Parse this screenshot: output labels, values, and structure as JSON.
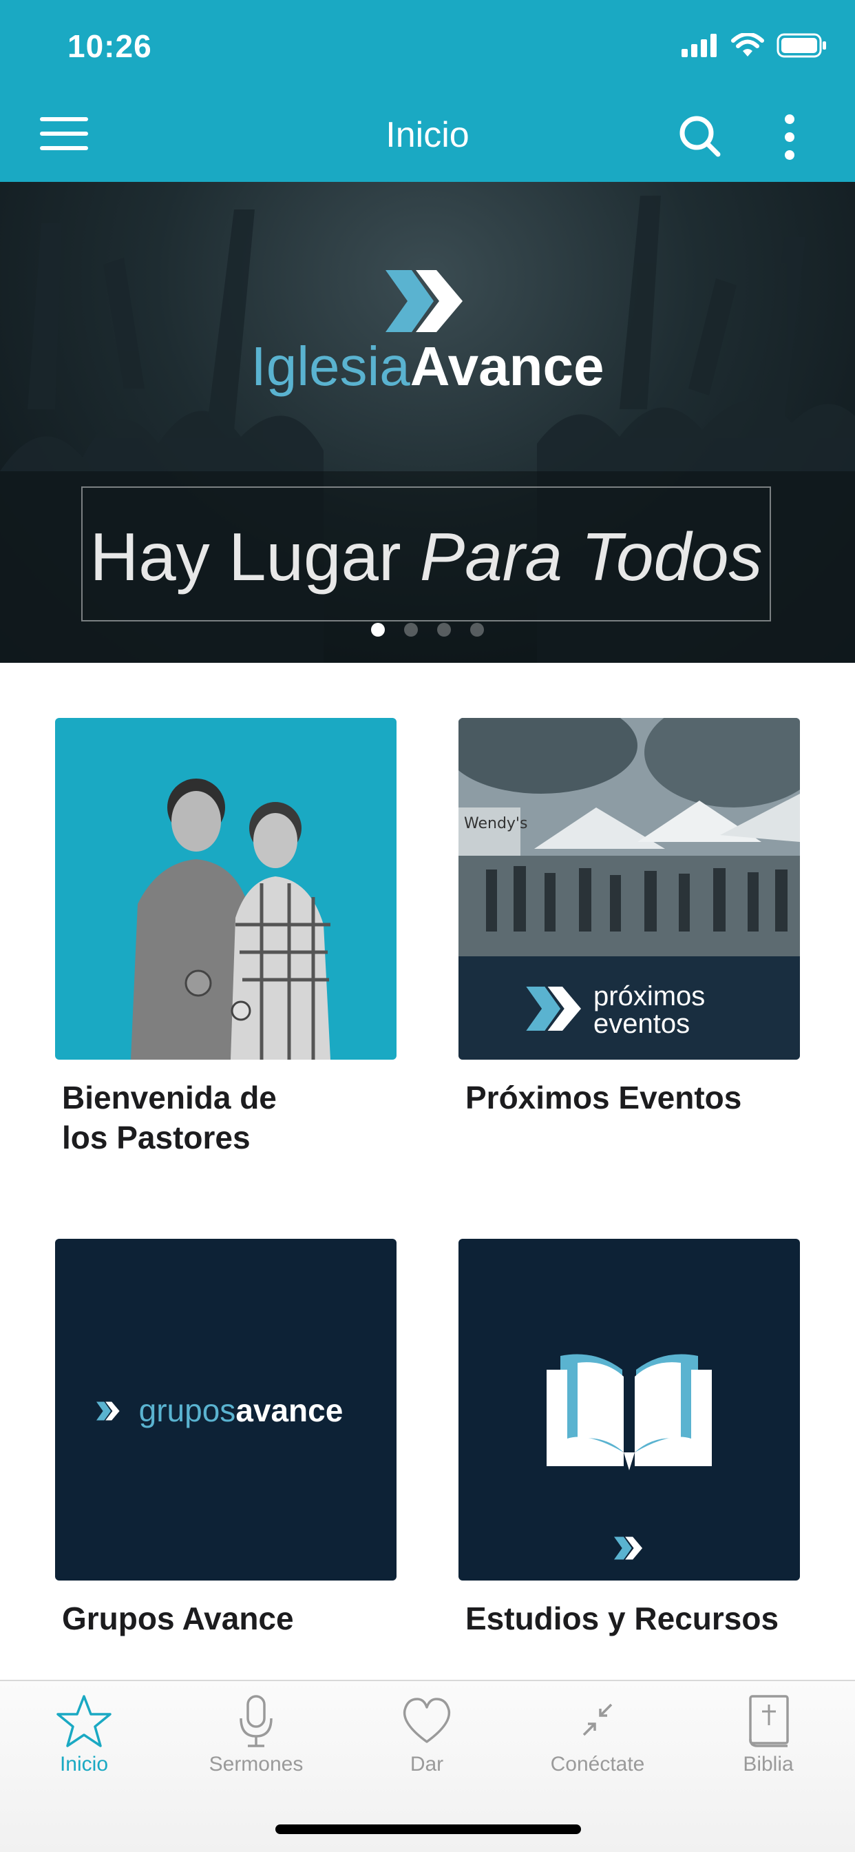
{
  "status_bar": {
    "time": "10:26"
  },
  "nav": {
    "title": "Inicio"
  },
  "hero": {
    "brand_light": "Iglesia",
    "brand_bold": "Avance",
    "tagline_regular": "Hay Lugar ",
    "tagline_italic": "Para Todos",
    "slide_count": 4,
    "active_slide": 1
  },
  "cards": [
    {
      "title": "Bienvenida de los Pastores"
    },
    {
      "title": "Próximos Eventos",
      "image_text": [
        "próximos",
        "eventos"
      ]
    },
    {
      "title": "Grupos Avance",
      "image_text_light": "grupos",
      "image_text_bold": "avance"
    },
    {
      "title": "Estudios y Recursos"
    }
  ],
  "tabs": [
    {
      "label": "Inicio",
      "icon": "star-icon",
      "active": true
    },
    {
      "label": "Sermones",
      "icon": "microphone-icon"
    },
    {
      "label": "Dar",
      "icon": "heart-icon"
    },
    {
      "label": "Conéctate",
      "icon": "arrows-in-icon"
    },
    {
      "label": "Biblia",
      "icon": "bible-icon"
    }
  ],
  "colors": {
    "accent": "#1aa9c3",
    "navy": "#0d2236",
    "brand_light_blue": "#5ab3d0"
  }
}
